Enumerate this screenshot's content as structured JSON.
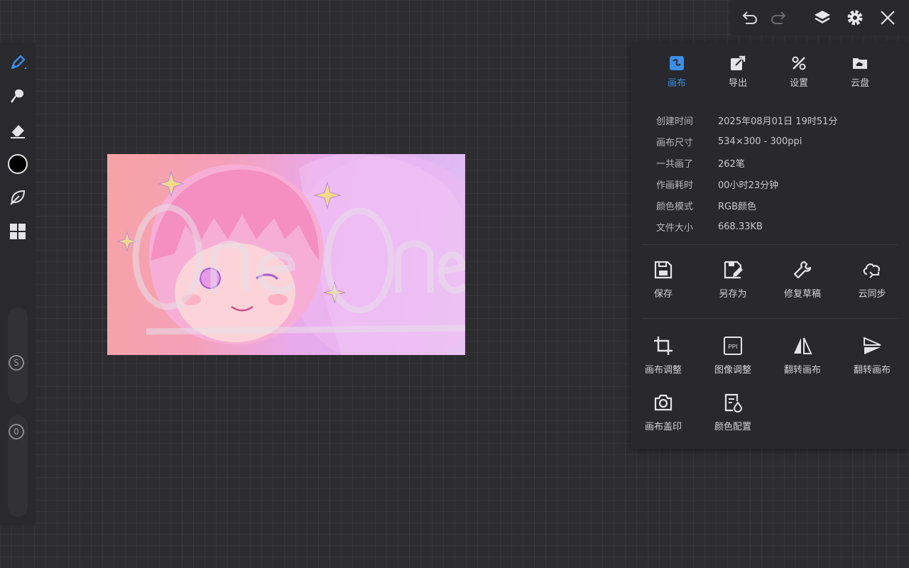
{
  "top_bar": {
    "undo_icon": "undo-icon",
    "redo_icon": "redo-icon",
    "layers_icon": "layers-icon",
    "settings_icon": "gear-icon",
    "close_icon": "close-icon"
  },
  "left_toolbar": {
    "tools": [
      "brush-icon",
      "smudge-icon",
      "eraser-icon",
      "color-swatch",
      "leaf-icon",
      "grid-icon"
    ],
    "brush_size_label": "S",
    "opacity_label": "0",
    "active_color": "#000000"
  },
  "panel": {
    "tabs": [
      {
        "label": "画布",
        "icon": "canvas-icon",
        "active": true
      },
      {
        "label": "导出",
        "icon": "export-icon",
        "active": false
      },
      {
        "label": "设置",
        "icon": "tools-icon",
        "active": false
      },
      {
        "label": "云盘",
        "icon": "cloud-folder-icon",
        "active": false
      }
    ],
    "info": [
      {
        "key": "创建时间",
        "value": "2025年08月01日 19时51分"
      },
      {
        "key": "画布尺寸",
        "value": "534×300 - 300ppi"
      },
      {
        "key": "一共画了",
        "value": "262笔"
      },
      {
        "key": "作画耗时",
        "value": "00小时23分钟"
      },
      {
        "key": "颜色模式",
        "value": "RGB颜色"
      },
      {
        "key": "文件大小",
        "value": "668.33KB"
      }
    ],
    "actions_row1": [
      {
        "label": "保存",
        "icon": "save-icon"
      },
      {
        "label": "另存为",
        "icon": "save-as-icon"
      },
      {
        "label": "修复草稿",
        "icon": "wrench-icon"
      },
      {
        "label": "云同步",
        "icon": "cloud-sync-icon"
      }
    ],
    "actions_row2": [
      {
        "label": "画布调整",
        "icon": "crop-icon"
      },
      {
        "label": "图像调整",
        "icon": "ppi-icon"
      },
      {
        "label": "翻转画布",
        "icon": "flip-horizontal-icon"
      },
      {
        "label": "翻转画布",
        "icon": "flip-vertical-icon"
      }
    ],
    "actions_row3": [
      {
        "label": "画布盖印",
        "icon": "camera-icon"
      },
      {
        "label": "颜色配置",
        "icon": "color-config-icon"
      }
    ]
  },
  "colors": {
    "accent": "#3c8ee8",
    "background": "#2d2c30",
    "panel": "#29282c"
  }
}
